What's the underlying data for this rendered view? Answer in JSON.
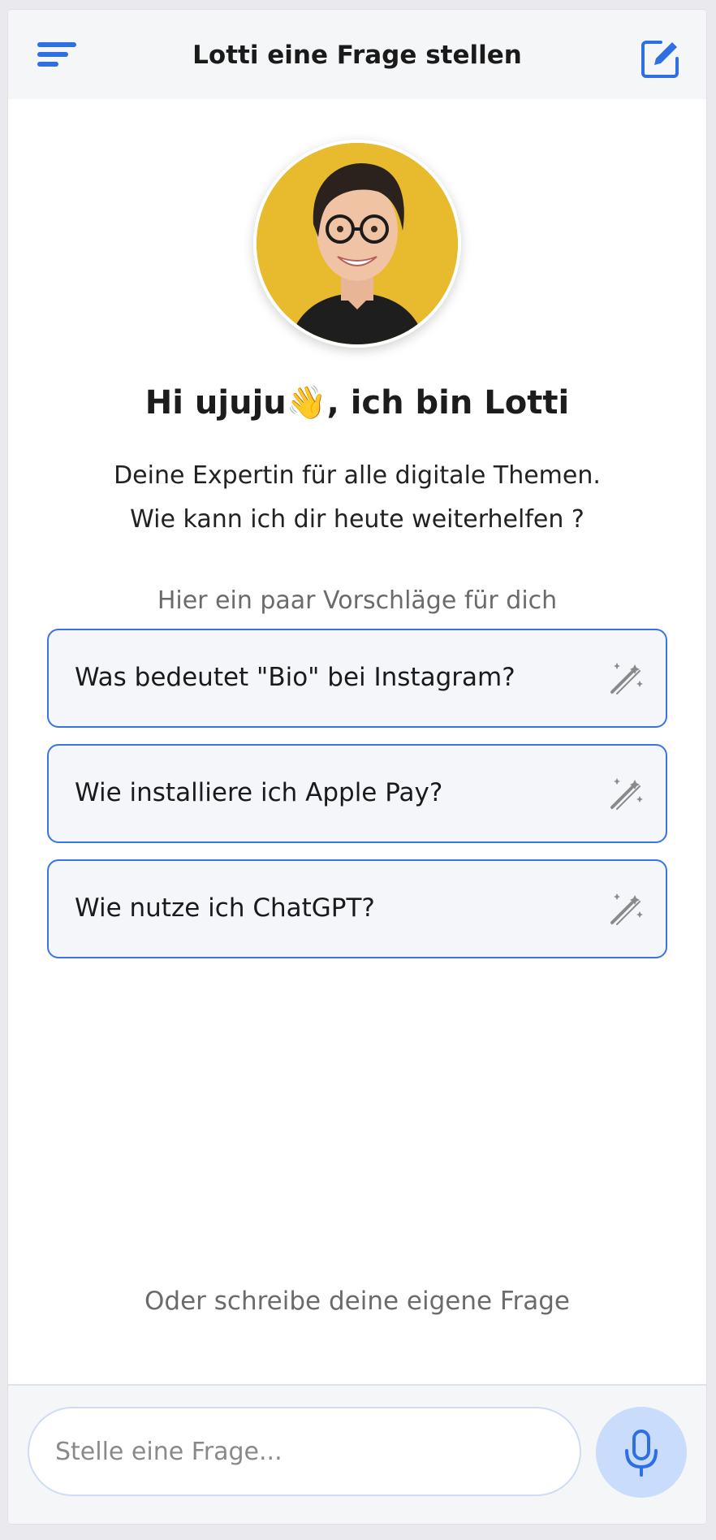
{
  "header": {
    "title": "Lotti eine Frage stellen",
    "menu_icon": "menu-icon",
    "edit_icon": "edit-icon"
  },
  "profile": {
    "avatar": "avatar",
    "greeting": "Hi ujuju👋, ich bin Lotti",
    "intro_line1": "Deine Expertin für alle digitale Themen.",
    "intro_line2": "Wie kann ich dir heute weiterhelfen ?"
  },
  "suggestions": {
    "label": "Hier ein paar Vorschläge für dich",
    "items": [
      {
        "text": "Was bedeutet \"Bio\" bei Instagram?",
        "icon": "magic-wand-icon"
      },
      {
        "text": "Wie installiere ich Apple Pay?",
        "icon": "magic-wand-icon"
      },
      {
        "text": "Wie nutze ich ChatGPT?",
        "icon": "magic-wand-icon"
      }
    ]
  },
  "own_question_label": "Oder schreibe deine eigene Frage",
  "composer": {
    "placeholder": "Stelle eine Frage...",
    "value": "",
    "mic_icon": "microphone-icon"
  },
  "colors": {
    "accent": "#2f6fe4",
    "avatar_bg": "#e8ba2e",
    "mic_bg": "#c9dcfb",
    "header_bg": "#f5f6f8"
  }
}
